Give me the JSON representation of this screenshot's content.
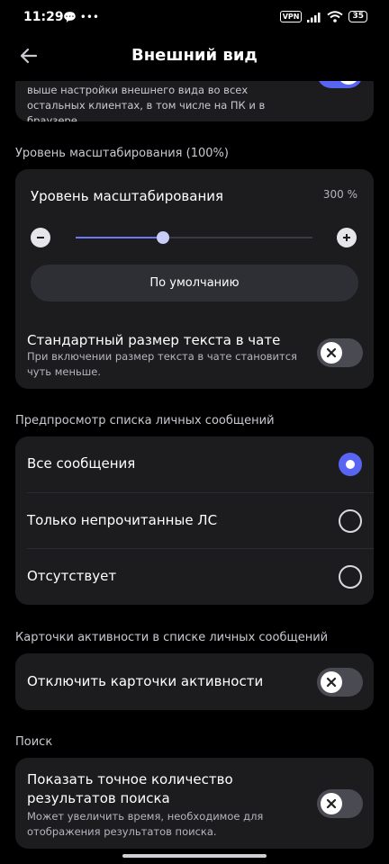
{
  "status_bar": {
    "time": "11:29",
    "left_icons": "💬 •••",
    "vpn": "VPN",
    "battery": "35"
  },
  "header": {
    "title": "Внешний вид"
  },
  "top_card": {
    "description": "выше настройки внешнего вида во всех остальных клиентах, в том числе на ПК и в браузере.",
    "toggle_on": true
  },
  "zoom_section": {
    "label": "Уровень масштабирования (100%)",
    "title": "Уровень масштабирования",
    "max": "300 %",
    "value_fraction": 0.37,
    "default_button": "По умолчанию",
    "chat_text_title": "Стандартный размер текста в чате",
    "chat_text_sub": "При включении размер текста в чате становится чуть меньше.",
    "chat_text_on": false
  },
  "dm_preview": {
    "label": "Предпросмотр списка личных сообщений",
    "options": [
      {
        "label": "Все сообщения",
        "selected": true
      },
      {
        "label": "Только непрочитанные ЛС",
        "selected": false
      },
      {
        "label": "Отсутствует",
        "selected": false
      }
    ]
  },
  "activity": {
    "label": "Карточки активности в списке личных сообщений",
    "title": "Отключить карточки активности",
    "on": false
  },
  "search": {
    "label": "Поиск",
    "title": "Показать точное количество результатов поиска",
    "sub": "Может увеличить время, необходимое для отображения результатов поиска.",
    "on": false
  },
  "colors": {
    "accent": "#5865f2",
    "card": "#1c1c1f",
    "background": "#000000"
  }
}
